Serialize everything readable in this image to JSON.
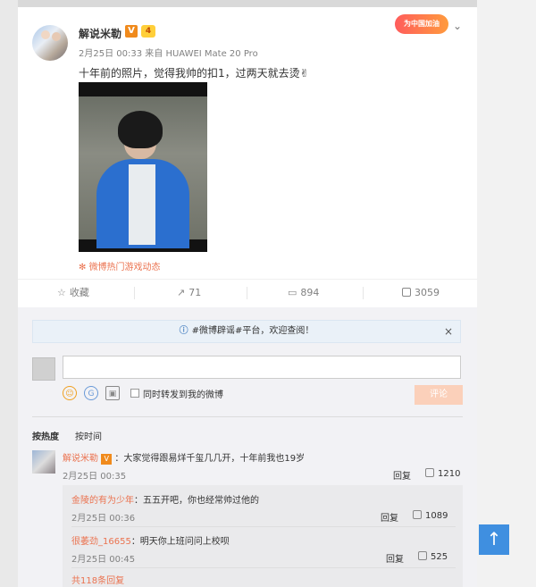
{
  "post": {
    "username": "解说米勒",
    "v_badge": "V",
    "level_badge": "4",
    "meta": "2月25日 00:33 来自 HUAWEI Mate 20 Pro",
    "promo_badge": "为中国加油",
    "text": "十年前的照片，觉得我帅的扣1，过两天就去烫✌",
    "hot_link": "微博热门游戏动态"
  },
  "actions": {
    "favorite": "收藏",
    "forward": "71",
    "comment": "894",
    "like": "3059"
  },
  "comments_panel": {
    "notice_text": "#微博辟谣#平台，欢迎查阅！",
    "notice_close": "×",
    "forward_checkbox_label": "同时转发到我的微博",
    "submit_label": "评论",
    "sort_hot": "按热度",
    "sort_time": "按时间"
  },
  "top_comment": {
    "author": "解说米勒",
    "text": "：大家觉得跟易烊千玺几几开，十年前我也19岁",
    "time": "2月25日 00:35",
    "reply_label": "回复",
    "likes": "1210"
  },
  "replies": [
    {
      "author": "金陵的有为少年",
      "text": "：五五开吧，你也经常帅过他的",
      "time": "2月25日 00:36",
      "reply_label": "回复",
      "likes": "1089"
    },
    {
      "author": "很萎劲_16655",
      "text": "：明天你上班问问上校呗",
      "time": "2月25日 00:45",
      "reply_label": "回复",
      "likes": "525"
    }
  ],
  "more_replies": "共118条回复",
  "colors": {
    "accent": "#eb7350",
    "link_blue": "#3f8fe0"
  }
}
